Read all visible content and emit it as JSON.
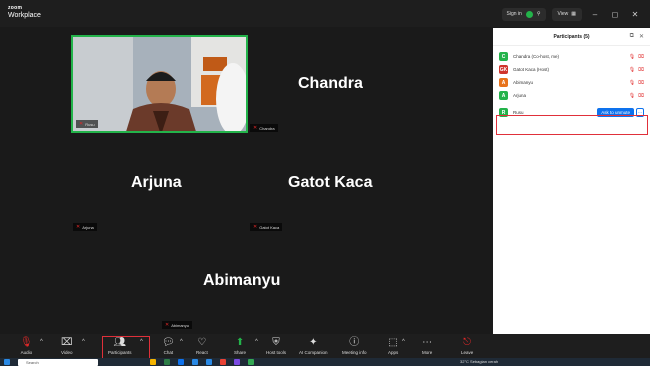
{
  "app": {
    "brand_top": "zoom",
    "brand_bottom": "Workplace"
  },
  "titlebar": {
    "signin_label": "Sign in",
    "view_label": "View"
  },
  "tiles": {
    "chandra": {
      "name": "Chandra",
      "label": "Chandra"
    },
    "rusu": {
      "label": "Rusu"
    },
    "arjuna": {
      "name": "Arjuna",
      "label": "Arjuna"
    },
    "gatot": {
      "name": "Gatot Kaca",
      "label": "Gatot Kaca"
    },
    "abimanyu": {
      "name": "Abimanyu",
      "label": "Abimanyu"
    }
  },
  "participants_panel": {
    "title": "Participants (5)",
    "rows": [
      {
        "initial": "C",
        "name": "Chandra (Co-host, me)",
        "color": "#23b34a"
      },
      {
        "initial": "GK",
        "name": "Gatot Kaca (Host)",
        "color": "#d0342c"
      },
      {
        "initial": "A",
        "name": "Abimanyu",
        "color": "#e8731b"
      },
      {
        "initial": "A",
        "name": "Arjuna",
        "color": "#23b34a"
      },
      {
        "initial": "R",
        "name": "Rusu",
        "color": "#23b34a",
        "action": "Ask to unmute"
      }
    ],
    "invite_label": "Invite",
    "mute_all_label": "Mute all"
  },
  "toolbar": {
    "audio": "Audio",
    "video": "Video",
    "participants": "Participants",
    "participants_count": "5",
    "chat": "Chat",
    "react": "React",
    "share": "Share",
    "host_tools": "Host tools",
    "ai_companion": "AI Companion",
    "meeting_info": "Meeting info",
    "apps": "Apps",
    "more": "More",
    "leave": "Leave"
  },
  "taskbar": {
    "search_label": "Search",
    "weather": "32°C Sebagian cerah"
  },
  "colors": {
    "accent": "#0e72ed",
    "highlight": "#e0303a",
    "active_speaker": "#23b34a"
  }
}
